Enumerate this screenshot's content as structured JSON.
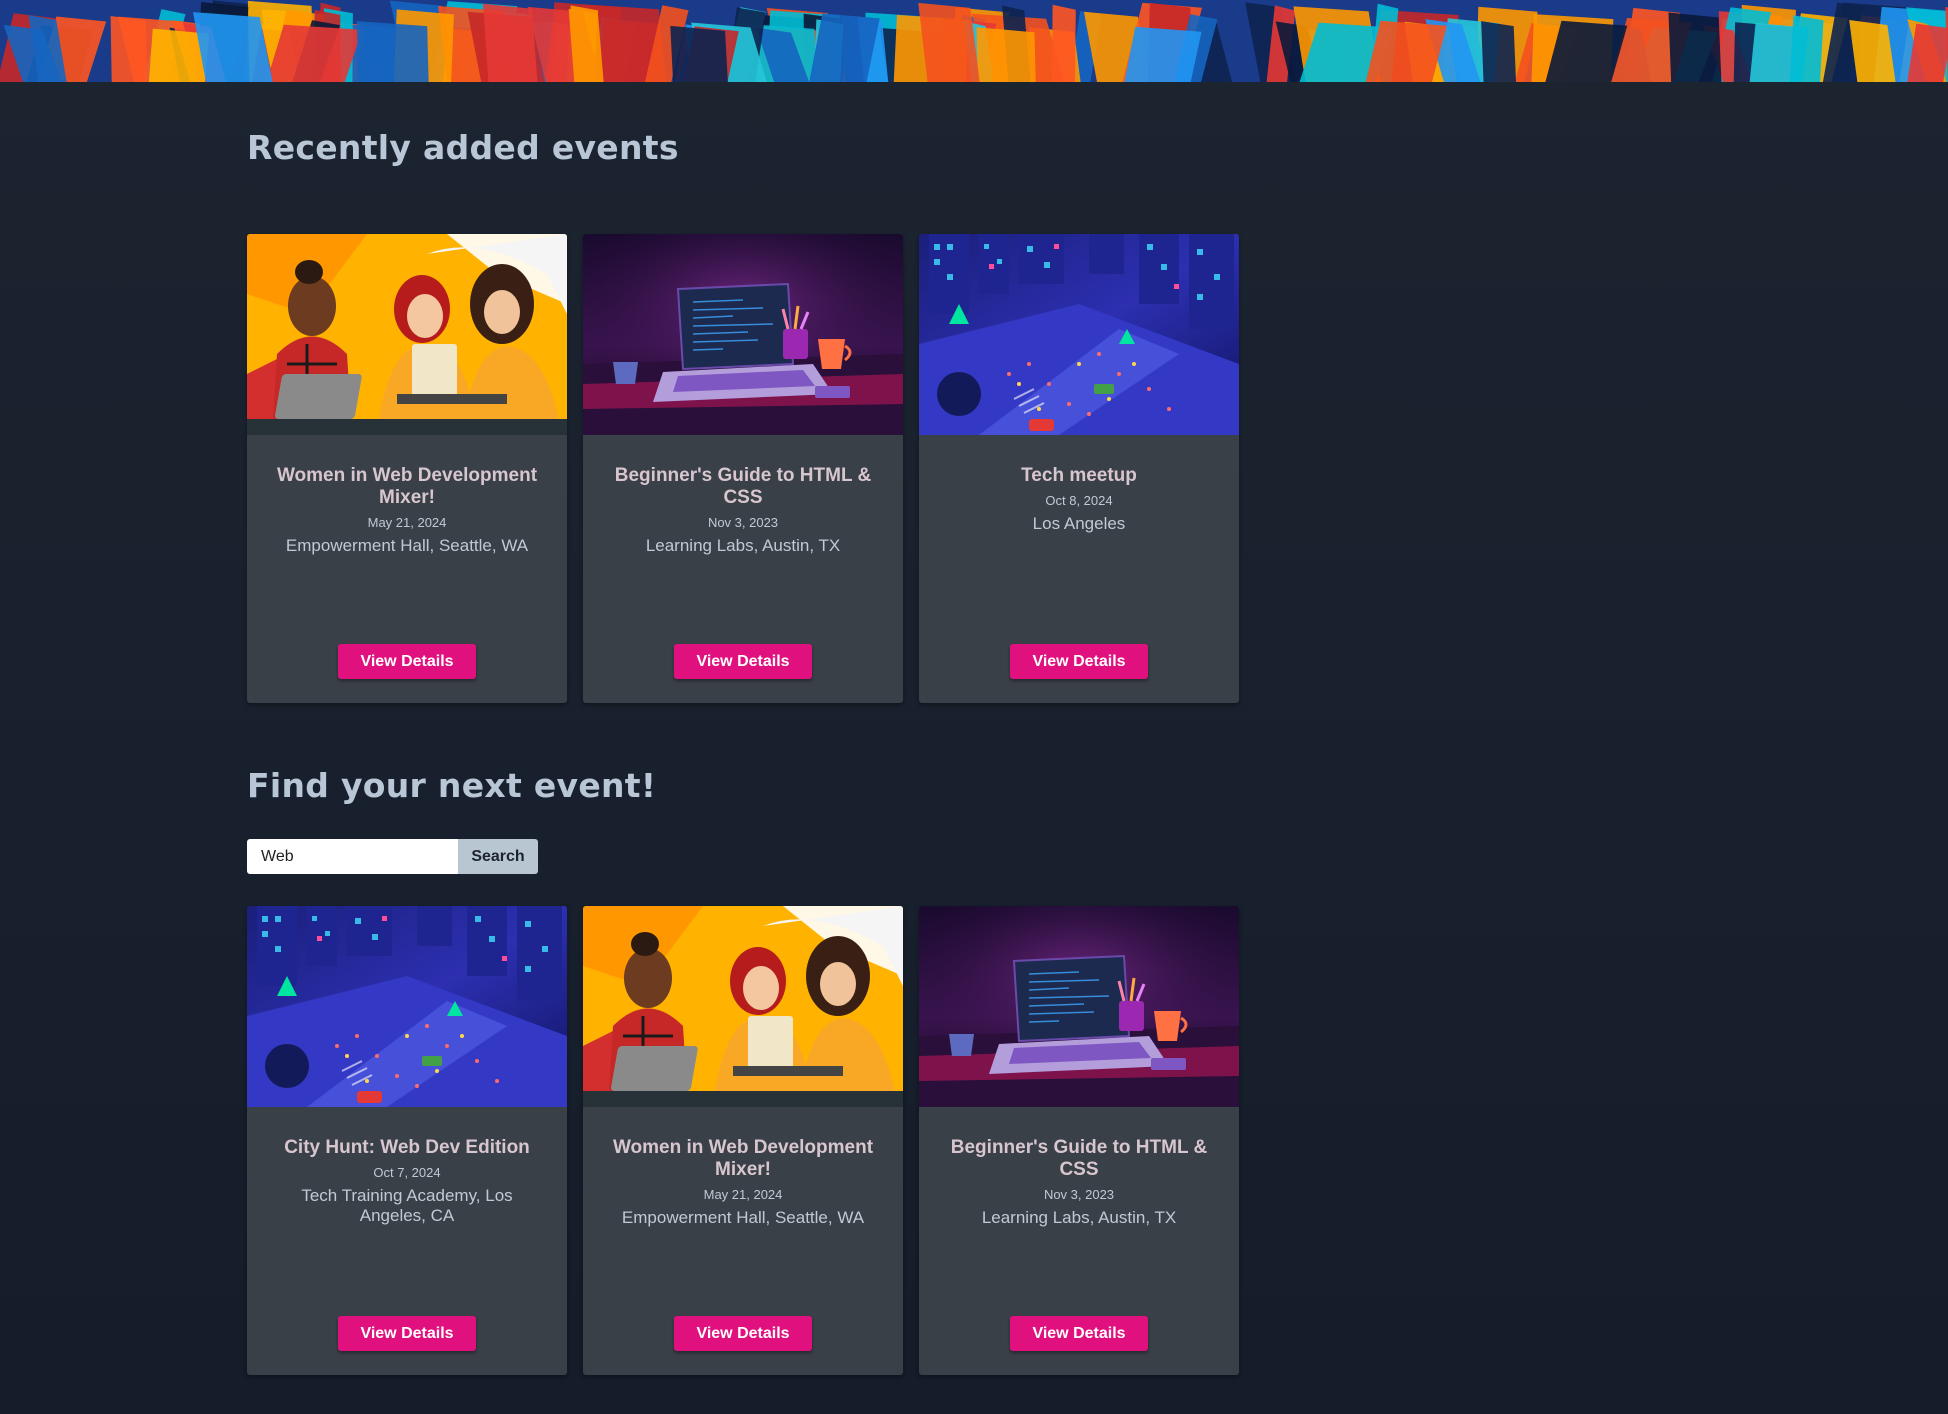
{
  "recent": {
    "title": "Recently added events",
    "cards": [
      {
        "title": "Women in Web Development Mixer!",
        "date": "May 21, 2024",
        "location": "Empowerment Hall, Seattle, WA",
        "button": "View Details",
        "image": "women-laptops-illustration"
      },
      {
        "title": "Beginner's Guide to HTML & CSS",
        "date": "Nov 3, 2023",
        "location": "Learning Labs, Austin, TX",
        "button": "View Details",
        "image": "laptop-desk-illustration"
      },
      {
        "title": "Tech meetup",
        "date": "Oct 8, 2024",
        "location": "Los Angeles",
        "button": "View Details",
        "image": "isometric-city-illustration"
      }
    ]
  },
  "find": {
    "title": "Find your next event!",
    "search_value": "Web",
    "search_button": "Search"
  },
  "results": {
    "cards": [
      {
        "title": "City Hunt: Web Dev Edition",
        "date": "Oct 7, 2024",
        "location": "Tech Training Academy, Los Angeles, CA",
        "button": "View Details",
        "image": "isometric-city-illustration"
      },
      {
        "title": "Women in Web Development Mixer!",
        "date": "May 21, 2024",
        "location": "Empowerment Hall, Seattle, WA",
        "button": "View Details",
        "image": "women-laptops-illustration"
      },
      {
        "title": "Beginner's Guide to HTML & CSS",
        "date": "Nov 3, 2023",
        "location": "Learning Labs, Austin, TX",
        "button": "View Details",
        "image": "laptop-desk-illustration"
      }
    ]
  },
  "colors": {
    "background": "#1a2230",
    "card": "#3a4048",
    "accent": "#e0117f",
    "search_button": "#b8c6d2"
  }
}
